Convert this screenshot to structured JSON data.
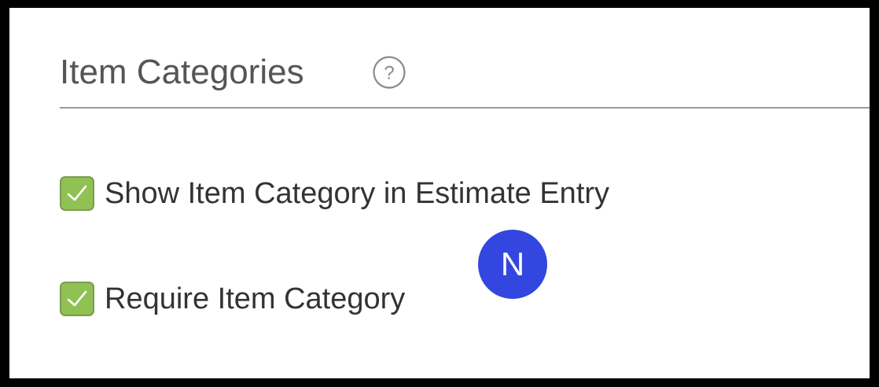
{
  "section": {
    "title": "Item Categories",
    "help_icon": "question-circle-icon"
  },
  "options": [
    {
      "label": "Show Item Category in Estimate Entry",
      "checked": true
    },
    {
      "label": "Require Item Category",
      "checked": true
    }
  ],
  "avatar": {
    "initial": "N",
    "color": "#3346e0"
  },
  "colors": {
    "checkbox_fill": "#8fc153",
    "checkbox_border": "#7d9a52",
    "title_text": "#555555",
    "divider": "#9a9a9a"
  }
}
